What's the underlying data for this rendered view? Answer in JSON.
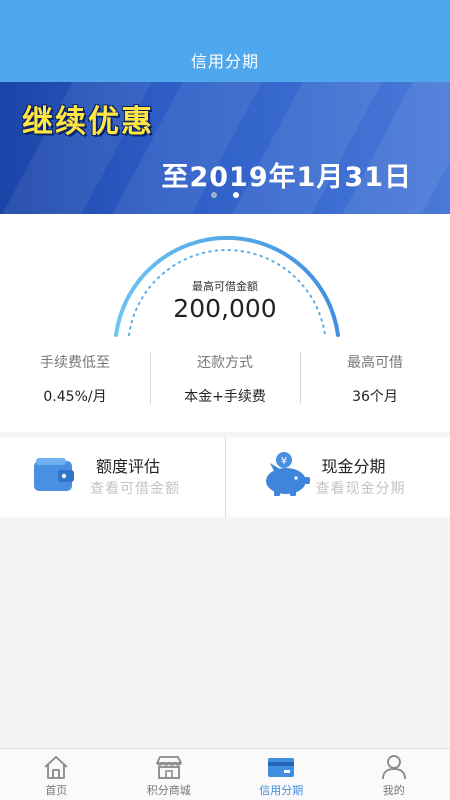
{
  "header": {
    "title": "信用分期"
  },
  "banner": {
    "headline": "继续优惠",
    "date_text": "至2019年1月31日",
    "slide_count": 2,
    "active_slide": 2
  },
  "limit": {
    "label": "最高可借金额",
    "amount": "200,000"
  },
  "stats": [
    {
      "label": "手续费低至",
      "value": "0.45%/月"
    },
    {
      "label": "还款方式",
      "value": "本金+手续费"
    },
    {
      "label": "最高可借",
      "value": "36个月"
    }
  ],
  "features": [
    {
      "title": "额度评估",
      "subtitle": "查看可借金额",
      "icon": "wallet-icon"
    },
    {
      "title": "现金分期",
      "subtitle": "查看现金分期",
      "icon": "piggy-bank-icon"
    }
  ],
  "tabbar": [
    {
      "label": "首页",
      "icon": "home-icon",
      "active": false
    },
    {
      "label": "积分商城",
      "icon": "store-icon",
      "active": false
    },
    {
      "label": "信用分期",
      "icon": "card-icon",
      "active": true
    },
    {
      "label": "我的",
      "icon": "user-icon",
      "active": false
    }
  ],
  "colors": {
    "primary": "#4fa8ee",
    "banner": "#2c5cc4",
    "banner_headline": "#ffe640",
    "tab_active": "#3e8fe0"
  }
}
